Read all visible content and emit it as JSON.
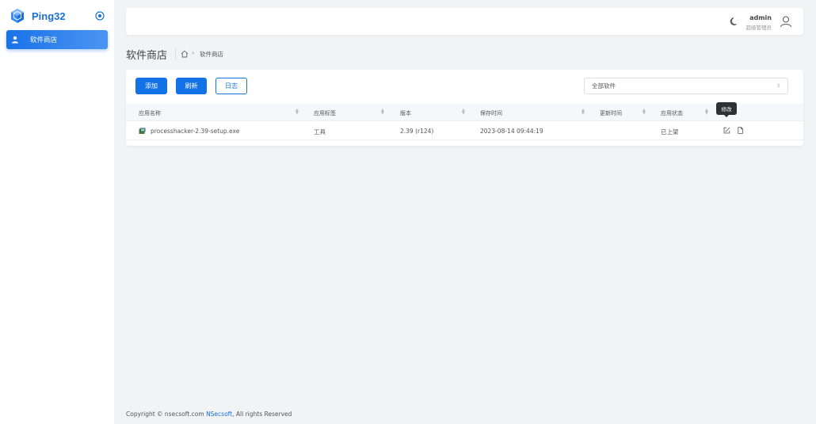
{
  "app": {
    "name": "Ping32"
  },
  "sidebar": {
    "items": [
      {
        "label": "软件商店",
        "icon": "user-icon"
      }
    ]
  },
  "header": {
    "username": "admin",
    "role": "超级管理员"
  },
  "page": {
    "title": "软件商店",
    "breadcrumb": [
      "软件商店"
    ]
  },
  "toolbar": {
    "add_label": "添加",
    "refresh_label": "刷新",
    "log_label": "日志"
  },
  "filter": {
    "selected": "全部软件"
  },
  "table": {
    "columns": [
      "应用名称",
      "应用标签",
      "版本",
      "保存时间",
      "更新时间",
      "应用状态"
    ],
    "rows": [
      {
        "name": "processhacker-2.39-setup.exe",
        "tag": "工具",
        "version": "2.39 (r124)",
        "saved_at": "2023-08-14 09:44:19",
        "updated_at": "",
        "status": "已上架"
      }
    ]
  },
  "tooltip": {
    "text": "修改"
  },
  "footer": {
    "prefix": "Copyright © nsecsoft.com",
    "brand": "NSecsoft",
    "suffix": ", All rights Reserved"
  },
  "colors": {
    "accent": "#1272e6",
    "brand": "#1a6fd9",
    "background": "#f2f3f5"
  }
}
